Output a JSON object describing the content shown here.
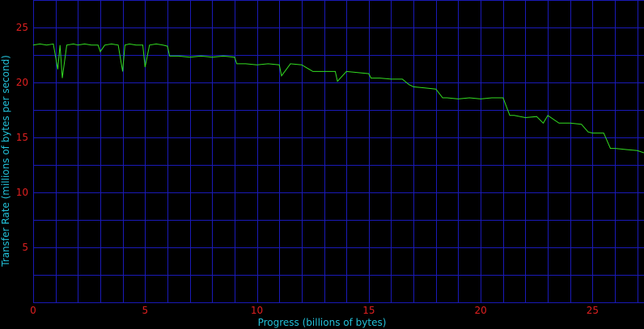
{
  "chart_data": {
    "type": "line",
    "xlabel": "Progress (billions of bytes)",
    "ylabel": "Transfer Rate (millions of bytes per second)",
    "xlim": [
      0,
      27.3
    ],
    "ylim": [
      0,
      27.5
    ],
    "x_ticks": [
      0,
      5,
      10,
      15,
      20,
      25
    ],
    "y_ticks": [
      5,
      10,
      15,
      20,
      25
    ],
    "grid": true,
    "colors": {
      "background": "#000000",
      "grid": "#1a1ab8",
      "line": "#33dd22",
      "tick_labels": "#e02020",
      "axis_titles": "#22c0d8"
    },
    "series": [
      {
        "x": [
          0,
          0.3,
          0.6,
          0.9,
          1.1,
          1.2,
          1.3,
          1.5,
          1.8,
          2.0,
          2.3,
          2.6,
          2.9,
          3.0,
          3.2,
          3.5,
          3.8,
          4.0,
          4.1,
          4.3,
          4.6,
          4.9,
          5.0,
          5.2,
          5.5,
          5.8,
          6.0,
          6.1,
          6.5,
          7.0,
          7.5,
          8.0,
          8.5,
          9.0,
          9.1,
          9.5,
          10.0,
          10.5,
          11.0,
          11.1,
          11.5,
          12.0,
          12.5,
          13.0,
          13.5,
          13.6,
          14.0,
          14.5,
          15.0,
          15.1,
          15.5,
          16.0,
          16.5,
          16.8,
          17.0,
          17.5,
          18.0,
          18.3,
          18.5,
          19.0,
          19.5,
          20.0,
          20.5,
          21.0,
          21.3,
          21.5,
          22.0,
          22.5,
          22.8,
          23.0,
          23.5,
          24.0,
          24.5,
          24.8,
          25.0,
          25.5,
          25.8,
          26.0,
          26.5,
          27.0,
          27.3
        ],
        "y": [
          23.4,
          23.5,
          23.4,
          23.5,
          21.2,
          23.4,
          20.4,
          23.4,
          23.5,
          23.4,
          23.5,
          23.4,
          23.4,
          22.8,
          23.4,
          23.5,
          23.4,
          21.0,
          23.4,
          23.5,
          23.4,
          23.4,
          21.4,
          23.4,
          23.5,
          23.4,
          23.3,
          22.4,
          22.4,
          22.3,
          22.4,
          22.3,
          22.4,
          22.3,
          21.7,
          21.7,
          21.6,
          21.7,
          21.6,
          20.6,
          21.7,
          21.6,
          21.0,
          21.0,
          21.0,
          20.1,
          21.0,
          20.9,
          20.8,
          20.4,
          20.4,
          20.3,
          20.3,
          19.8,
          19.6,
          19.5,
          19.4,
          18.6,
          18.6,
          18.5,
          18.6,
          18.5,
          18.6,
          18.6,
          17.0,
          17.0,
          16.8,
          16.9,
          16.3,
          17.0,
          16.3,
          16.3,
          16.2,
          15.5,
          15.4,
          15.4,
          14.0,
          14.0,
          13.9,
          13.8,
          13.6
        ]
      }
    ]
  }
}
